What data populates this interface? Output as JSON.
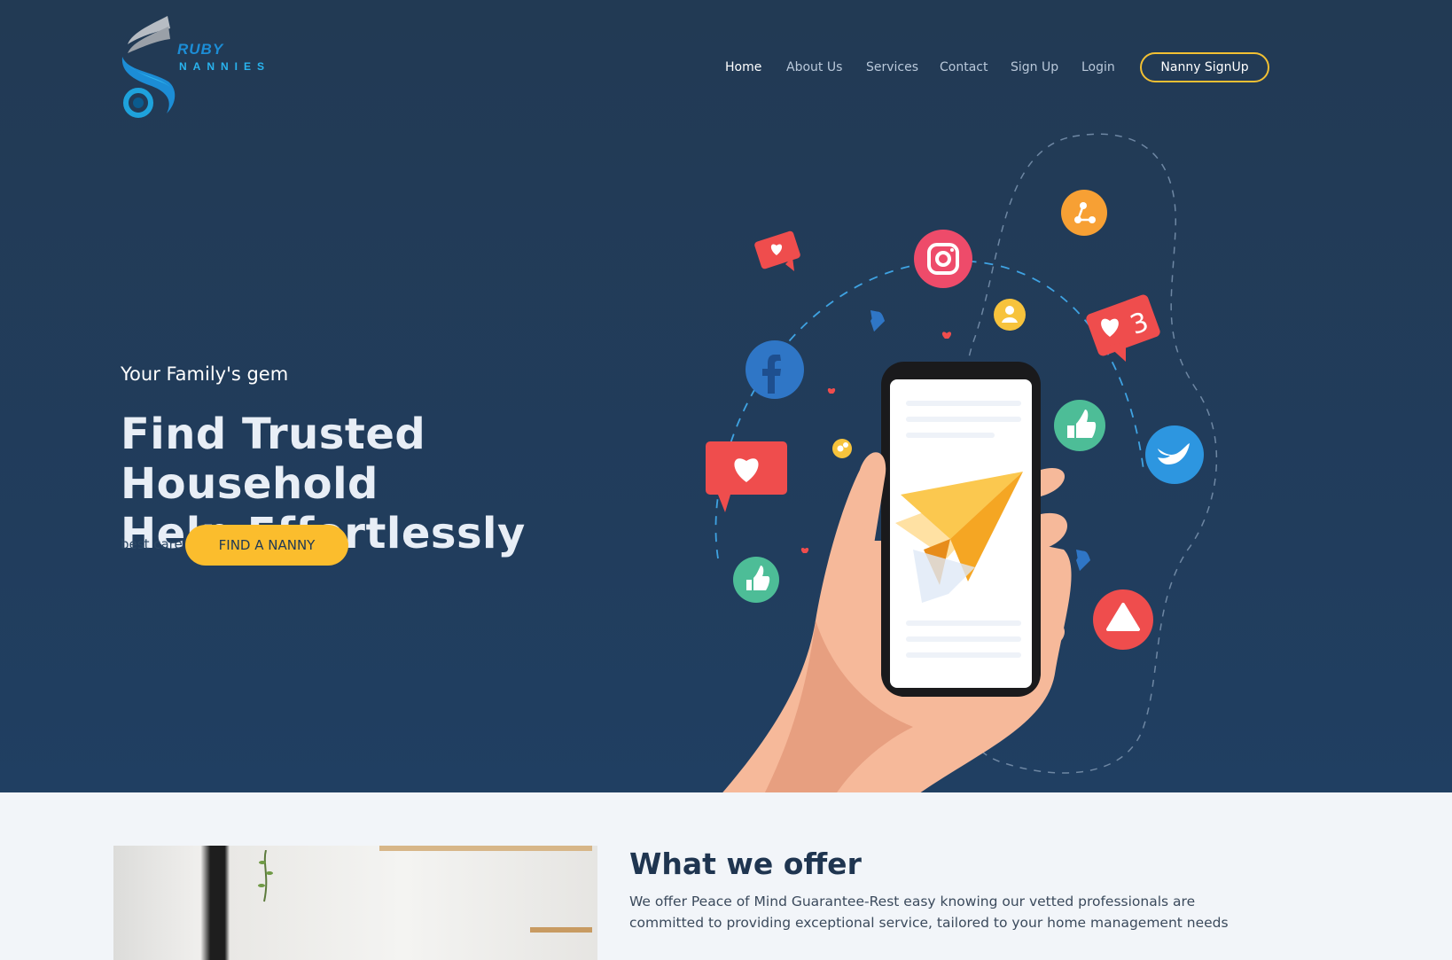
{
  "brand": {
    "name_top": "RUBY",
    "name_bottom": "NANNIES",
    "colors": {
      "primary": "#1c8dd6",
      "accent": "#fbbd2d",
      "hero_bg": "#223a54"
    }
  },
  "nav": {
    "items": [
      {
        "label": "Home",
        "active": true
      },
      {
        "label": "About Us",
        "active": false
      },
      {
        "label": "Services",
        "active": false
      },
      {
        "label": "Contact",
        "active": false
      },
      {
        "label": "Sign Up",
        "active": false
      },
      {
        "label": "Login",
        "active": false
      }
    ],
    "cta_label": "Nanny SignUp"
  },
  "hero": {
    "tagline": "Your Family's gem",
    "headline_line1": "Find Trusted Household",
    "headline_line2": "Help Effortlessly",
    "subtle_text": "best care",
    "cta_label": "FIND A NANNY",
    "illustration_badge": "3"
  },
  "offer": {
    "title": "What we offer",
    "description": "We offer Peace of Mind Guarantee-Rest easy knowing our vetted professionals are committed to providing exceptional service, tailored to your home management needs"
  }
}
